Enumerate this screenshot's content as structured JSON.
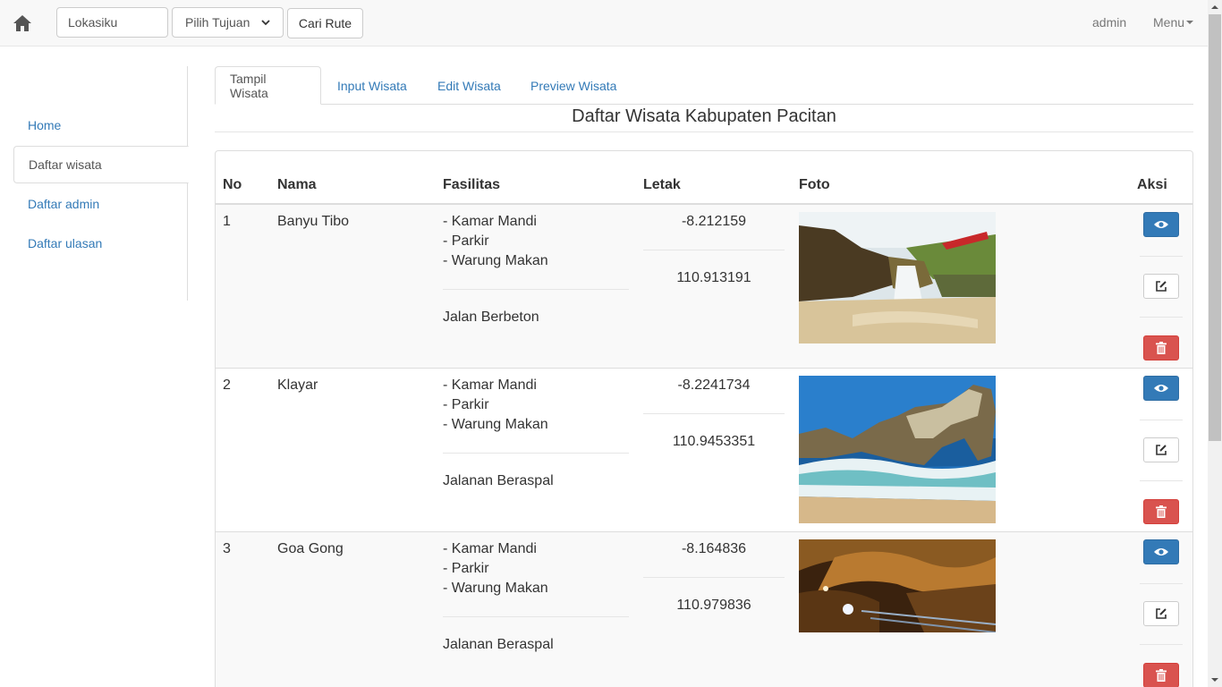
{
  "navbar": {
    "location_value": "Lokasiku",
    "destination_selected": "Pilih Tujuan",
    "route_button": "Cari Rute",
    "user": "admin",
    "menu": "Menu"
  },
  "sidebar": {
    "items": [
      {
        "label": "Home"
      },
      {
        "label": "Daftar wisata"
      },
      {
        "label": "Daftar admin"
      },
      {
        "label": "Daftar ulasan"
      }
    ]
  },
  "tabs": [
    {
      "label": "Tampil Wisata"
    },
    {
      "label": "Input Wisata"
    },
    {
      "label": "Edit Wisata"
    },
    {
      "label": "Preview Wisata"
    }
  ],
  "page_title": "Daftar Wisata Kabupaten Pacitan",
  "table": {
    "headers": {
      "no": "No",
      "nama": "Nama",
      "fasilitas": "Fasilitas",
      "letak": "Letak",
      "foto": "Foto",
      "aksi": "Aksi"
    },
    "rows": [
      {
        "no": "1",
        "nama": "Banyu Tibo",
        "fasilitas": [
          "- Kamar Mandi",
          "- Parkir",
          "- Warung Makan"
        ],
        "jalan": "Jalan Berbeton",
        "lat": "-8.212159",
        "lng": "110.913191",
        "photo_subject": "waterfall-beach"
      },
      {
        "no": "2",
        "nama": "Klayar",
        "fasilitas": [
          "- Kamar Mandi",
          "- Parkir",
          "- Warung Makan"
        ],
        "jalan": "Jalanan Beraspal",
        "lat": "-8.2241734",
        "lng": "110.9453351",
        "photo_subject": "rocky-beach-waves"
      },
      {
        "no": "3",
        "nama": "Goa Gong",
        "fasilitas": [
          "- Kamar Mandi",
          "- Parkir",
          "- Warung Makan"
        ],
        "jalan": "Jalanan Beraspal",
        "lat": "-8.164836",
        "lng": "110.979836",
        "photo_subject": "lit-cave-interior"
      }
    ]
  },
  "icons": {
    "home": "home-icon",
    "view": "eye-icon",
    "edit": "edit-icon",
    "delete": "trash-icon"
  },
  "colors": {
    "link": "#337ab7",
    "primary": "#337ab7",
    "danger": "#d9534f"
  }
}
